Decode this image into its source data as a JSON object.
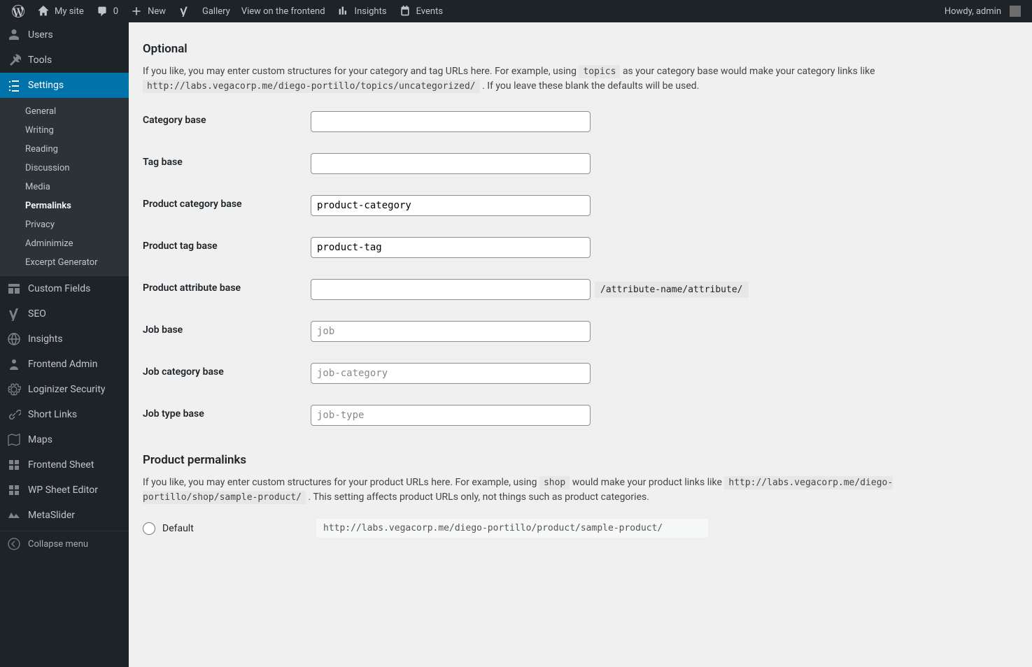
{
  "adminbar": {
    "site": "My site",
    "comments": "0",
    "new": "New",
    "gallery": "Gallery",
    "frontend": "View on the frontend",
    "insights": "Insights",
    "events": "Events",
    "howdy": "Howdy, admin"
  },
  "sidebar": {
    "users": "Users",
    "tools": "Tools",
    "settings": "Settings",
    "sub": {
      "general": "General",
      "writing": "Writing",
      "reading": "Reading",
      "discussion": "Discussion",
      "media": "Media",
      "permalinks": "Permalinks",
      "privacy": "Privacy",
      "adminimize": "Adminimize",
      "excerpt": "Excerpt Generator"
    },
    "custom_fields": "Custom Fields",
    "seo": "SEO",
    "insights": "Insights",
    "frontend_admin": "Frontend Admin",
    "loginizer": "Loginizer Security",
    "short_links": "Short Links",
    "maps": "Maps",
    "frontend_sheet": "Frontend Sheet",
    "sheet_editor": "WP Sheet Editor",
    "metaslider": "MetaSlider",
    "collapse": "Collapse menu"
  },
  "content": {
    "section1_title": "Optional",
    "section1_desc_a": "If you like, you may enter custom structures for your category and tag URLs here. For example, using ",
    "section1_desc_code1": "topics",
    "section1_desc_b": " as your category base would make your category links like ",
    "section1_desc_code2": "http://labs.vegacorp.me/diego-portillo/topics/uncategorized/",
    "section1_desc_c": " . If you leave these blank the defaults will be used.",
    "fields": {
      "cat_base": {
        "label": "Category base",
        "value": ""
      },
      "tag_base": {
        "label": "Tag base",
        "value": ""
      },
      "prod_cat": {
        "label": "Product category base",
        "value": "product-category"
      },
      "prod_tag": {
        "label": "Product tag base",
        "value": "product-tag"
      },
      "prod_attr": {
        "label": "Product attribute base",
        "value": "",
        "hint": "/attribute-name/attribute/"
      },
      "job": {
        "label": "Job base",
        "placeholder": "job"
      },
      "job_cat": {
        "label": "Job category base",
        "placeholder": "job-category"
      },
      "job_type": {
        "label": "Job type base",
        "placeholder": "job-type"
      }
    },
    "section2_title": "Product permalinks",
    "section2_desc_a": "If you like, you may enter custom structures for your product URLs here. For example, using ",
    "section2_desc_code1": "shop",
    "section2_desc_b": " would make your product links like ",
    "section2_desc_code2": "http://labs.vegacorp.me/diego-portillo/shop/sample-product/",
    "section2_desc_c": " . This setting affects product URLs only, not things such as product categories.",
    "permalink_default": {
      "label": "Default",
      "url": "http://labs.vegacorp.me/diego-portillo/product/sample-product/"
    }
  }
}
